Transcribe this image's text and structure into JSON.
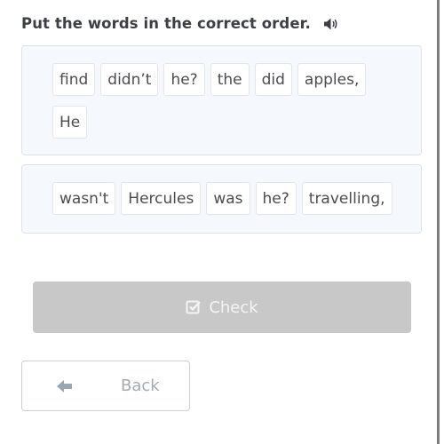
{
  "header": {
    "title": "Put the words in the correct order.",
    "audio_icon": "speaker-volume-icon"
  },
  "sentences": [
    {
      "words": [
        "find",
        "didn’t",
        "he?",
        "the",
        "did",
        "apples,",
        "He"
      ]
    },
    {
      "words": [
        "wasn't",
        "Hercules",
        "was",
        "he?",
        "travelling,"
      ]
    }
  ],
  "actions": {
    "check_label": "Check",
    "check_icon": "check-square-icon",
    "check_enabled": false,
    "back_label": "Back",
    "back_icon": "arrow-left-icon"
  },
  "colors": {
    "title": "#3d3f44",
    "box_bg": "#f5f8fc",
    "check_disabled_bg": "#c8c8c8",
    "back_text": "#a3aab1"
  }
}
